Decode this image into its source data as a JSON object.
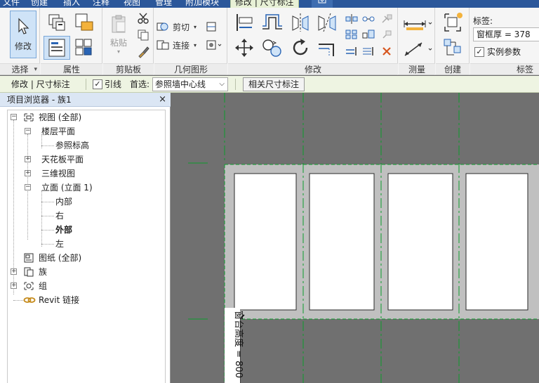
{
  "tabs": [
    {
      "label": "文件",
      "active": false
    },
    {
      "label": "创建",
      "active": false
    },
    {
      "label": "插入",
      "active": false
    },
    {
      "label": "注释",
      "active": false
    },
    {
      "label": "视图",
      "active": false
    },
    {
      "label": "管理",
      "active": false
    },
    {
      "label": "附加模块",
      "active": false
    },
    {
      "label": "修改 | 尺寸标注",
      "active": true
    }
  ],
  "ribbon": {
    "select": {
      "modify_label": "修改",
      "panel_label": "选择"
    },
    "properties": {
      "panel_label": "属性"
    },
    "clipboard": {
      "paste_label": "粘贴",
      "panel_label": "剪贴板"
    },
    "geometry": {
      "cut_label": "剪切",
      "join_label": "连接",
      "panel_label": "几何图形"
    },
    "modify": {
      "panel_label": "修改"
    },
    "measure": {
      "panel_label": "测量"
    },
    "create": {
      "panel_label": "创建"
    },
    "label_panel": {
      "label_caption": "标签:",
      "label_value": "窗框厚 = 378",
      "instance_param_label": "实例参数",
      "instance_param_checked": true,
      "panel_label": "标签"
    }
  },
  "options_bar": {
    "context": "修改 | 尺寸标注",
    "leader_label": "引线",
    "leader_checked": true,
    "prefer_label": "首选:",
    "prefer_value": "参照墙中心线",
    "related_dim_button": "相关尺寸标注"
  },
  "browser": {
    "title": "项目浏览器 - 族1",
    "close_glyph": "×",
    "nodes": [
      {
        "label": "视图 (全部)",
        "level": 0,
        "expander": "−",
        "icon": "views-icon"
      },
      {
        "label": "楼层平面",
        "level": 1,
        "expander": "−"
      },
      {
        "label": "参照标高",
        "level": 2
      },
      {
        "label": "天花板平面",
        "level": 1,
        "expander": "+"
      },
      {
        "label": "三维视图",
        "level": 1,
        "expander": "+"
      },
      {
        "label": "立面 (立面 1)",
        "level": 1,
        "expander": "−"
      },
      {
        "label": "内部",
        "level": 2
      },
      {
        "label": "右",
        "level": 2
      },
      {
        "label": "外部",
        "level": 2,
        "bold": true
      },
      {
        "label": "左",
        "level": 2
      },
      {
        "label": "图纸 (全部)",
        "level": 0,
        "icon": "sheets-icon"
      },
      {
        "label": "族",
        "level": 0,
        "expander": "+",
        "icon": "families-icon"
      },
      {
        "label": "组",
        "level": 0,
        "expander": "+",
        "icon": "groups-icon"
      },
      {
        "label": "Revit 链接",
        "level": 0,
        "icon": "revit-links-icon"
      }
    ]
  },
  "canvas": {
    "dimension_text": "窗台高度 = 800"
  },
  "colors": {
    "tab_bar": "#2b579a",
    "active_tab": "#e8f1d6",
    "options_bar": "#eef4e2",
    "canvas_bg": "#707070",
    "frame": "#c0c0c0",
    "reference_plane": "#0c9b2c"
  }
}
